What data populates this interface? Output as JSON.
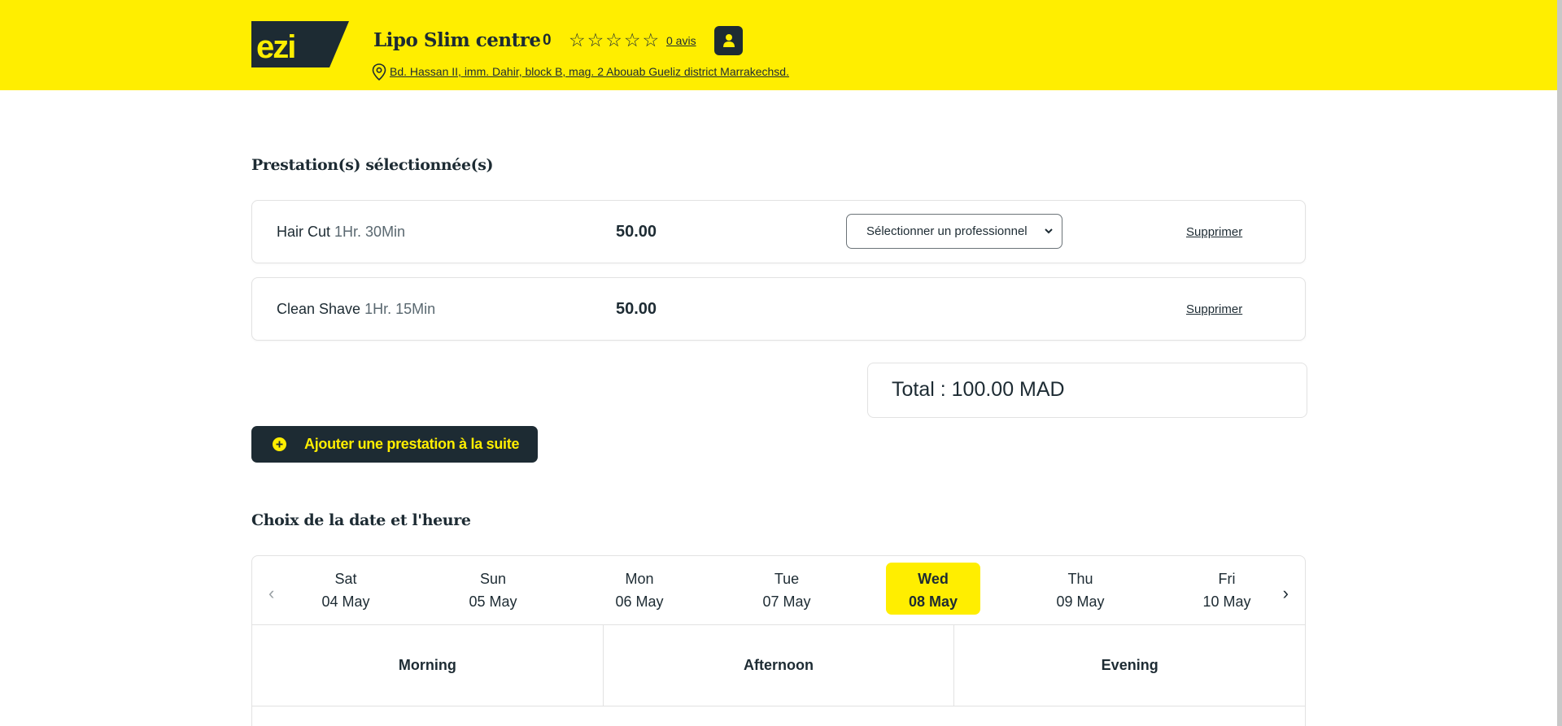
{
  "brand": {
    "logo_text": "ezi",
    "accent": "#ffee00",
    "dark": "#1d2b33"
  },
  "shop": {
    "name": "Lipo Slim centre",
    "rating": "0",
    "stars_total": 5,
    "reviews_label": "0 avis",
    "address": " Bd. Hassan II, imm. Dahir, block B, mag. 2 Abouab Gueliz district Marrakechsd."
  },
  "services_section": {
    "title": "Prestation(s) sélectionnée(s)",
    "items": [
      {
        "name": "Hair Cut",
        "duration": "1Hr. 30Min",
        "price": "50.00",
        "professional_placeholder": "Sélectionner un professionnel",
        "delete_label": "Supprimer"
      },
      {
        "name": "Clean Shave",
        "duration": "1Hr. 15Min",
        "price": "50.00",
        "delete_label": "Supprimer"
      }
    ],
    "total": "Total : 100.00 MAD",
    "add_button": "Ajouter une prestation à la suite"
  },
  "datetime_section": {
    "title": "Choix de la date et l'heure",
    "days": [
      {
        "day": "Sat",
        "date": "04 May"
      },
      {
        "day": "Sun",
        "date": "05 May"
      },
      {
        "day": "Mon",
        "date": "06 May"
      },
      {
        "day": "Tue",
        "date": "07 May"
      },
      {
        "day": "Wed",
        "date": "08 May",
        "selected": true
      },
      {
        "day": "Thu",
        "date": "09 May"
      },
      {
        "day": "Fri",
        "date": "10 May"
      }
    ],
    "periods": [
      "Morning",
      "Afternoon",
      "Evening"
    ],
    "prev_icon": "chevron-left-icon",
    "next_icon": "chevron-right-icon"
  }
}
